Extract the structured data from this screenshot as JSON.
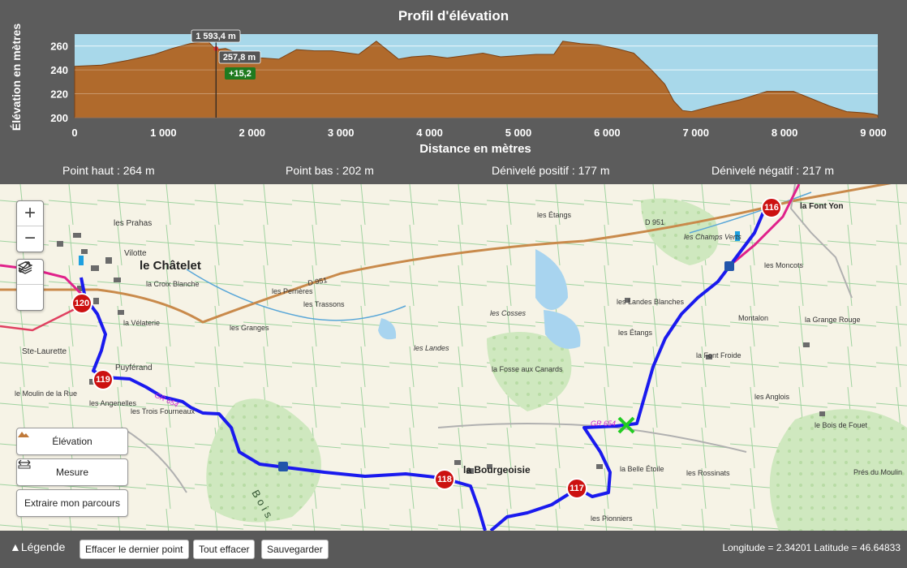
{
  "elevation": {
    "title": "Profil d'élévation",
    "ylabel": "Élévation en mètres",
    "xlabel": "Distance en mètres",
    "cursor_distance": "1 593,4 m",
    "cursor_elevation": "257,8 m",
    "cursor_gain": "+15,2",
    "colors": {
      "fill": "#b06a2c",
      "background": "#a8d8ea",
      "gain_badge": "#1f7a1f"
    }
  },
  "chart_data": {
    "type": "area",
    "xlabel": "Distance en mètres",
    "ylabel": "Élévation en mètres",
    "xlim": [
      0,
      9050
    ],
    "ylim": [
      200,
      270
    ],
    "xticks": [
      "0",
      "1 000",
      "2 000",
      "3 000",
      "4 000",
      "5 000",
      "6 000",
      "7 000",
      "8 000",
      "9 000"
    ],
    "yticks": [
      "200",
      "220",
      "240",
      "260"
    ],
    "x": [
      0,
      300,
      600,
      900,
      1100,
      1300,
      1500,
      1593,
      1700,
      1900,
      2100,
      2300,
      2500,
      2700,
      2900,
      3200,
      3400,
      3500,
      3650,
      3800,
      4000,
      4200,
      4400,
      4600,
      4800,
      5000,
      5200,
      5400,
      5500,
      5700,
      5900,
      6100,
      6300,
      6500,
      6650,
      6750,
      6850,
      6950,
      7200,
      7500,
      7800,
      8100,
      8300,
      8500,
      8700,
      8900,
      9000,
      9050
    ],
    "y": [
      243,
      244,
      248,
      253,
      258,
      262,
      264,
      257,
      258,
      252,
      250,
      249,
      257,
      256,
      256,
      253,
      264,
      258,
      249,
      251,
      252,
      250,
      252,
      254,
      251,
      252,
      253,
      253,
      264,
      262,
      261,
      258,
      254,
      240,
      228,
      214,
      206,
      205,
      210,
      215,
      222,
      222,
      216,
      210,
      205,
      204,
      203,
      202
    ],
    "series": []
  },
  "stats": {
    "high": "Point haut : 264 m",
    "low": "Point bas : 202 m",
    "gain": "Dénivelé positif : 177 m",
    "loss": "Dénivelé négatif : 217 m"
  },
  "map": {
    "markers": [
      "116",
      "117",
      "118",
      "119",
      "120"
    ],
    "places": {
      "chatelet": "le Châtelet",
      "bourgeoisie": "la Bourgeoisie",
      "font_yon": "la Font Yon",
      "champs_verts": "les Champs Verts",
      "moncots": "les Moncots",
      "etangs": "les Étangs",
      "cosses": "les Cosses",
      "landes": "les Landes",
      "fosse": "la Fosse aux Canards",
      "trois_fourneaux": "les Trois Fourneaux",
      "ste_laurette": "Ste-Laurette",
      "puyferand": "Puyférand",
      "velaterie": "la Vélaterie",
      "croix_blanche": "la Croix Blanche",
      "prahas": "les Prahas",
      "vilotte": "Vilotte",
      "granges": "les Granges",
      "trassons": "les Trassons",
      "perrieres": "les Perrières",
      "rossinats": "les Rossinats",
      "pionniers": "les Pionniers",
      "belle_etoile": "la Belle Étoile",
      "bois": "Bois",
      "angenelles": "les Angenelles",
      "moulin_rue": "le Moulin de la Rue",
      "landes_blanches": "les Landes Blanches",
      "font_froide": "la Font Froide",
      "grande_rouge": "la Grange Rouge",
      "anglois": "les Anglois",
      "montalon": "Montalon",
      "bois_fouet": "le Bois de Fouet",
      "pres_moulin": "Prés du Moulin",
      "gr654": "GR 654",
      "d951": "D 951"
    },
    "colors": {
      "route": "#1a1aee",
      "marker": "#cc1111"
    }
  },
  "panel_buttons": {
    "elevation": "Élévation",
    "measure": "Mesure",
    "extract": "Extraire mon parcours"
  },
  "zoom": {
    "in": "+",
    "out": "−"
  },
  "bottom": {
    "legend": "Légende",
    "undo": "Effacer le dernier point",
    "clear": "Tout effacer",
    "save": "Sauvegarder",
    "coords": "Longitude = 2.34201 Latitude = 46.64833"
  }
}
